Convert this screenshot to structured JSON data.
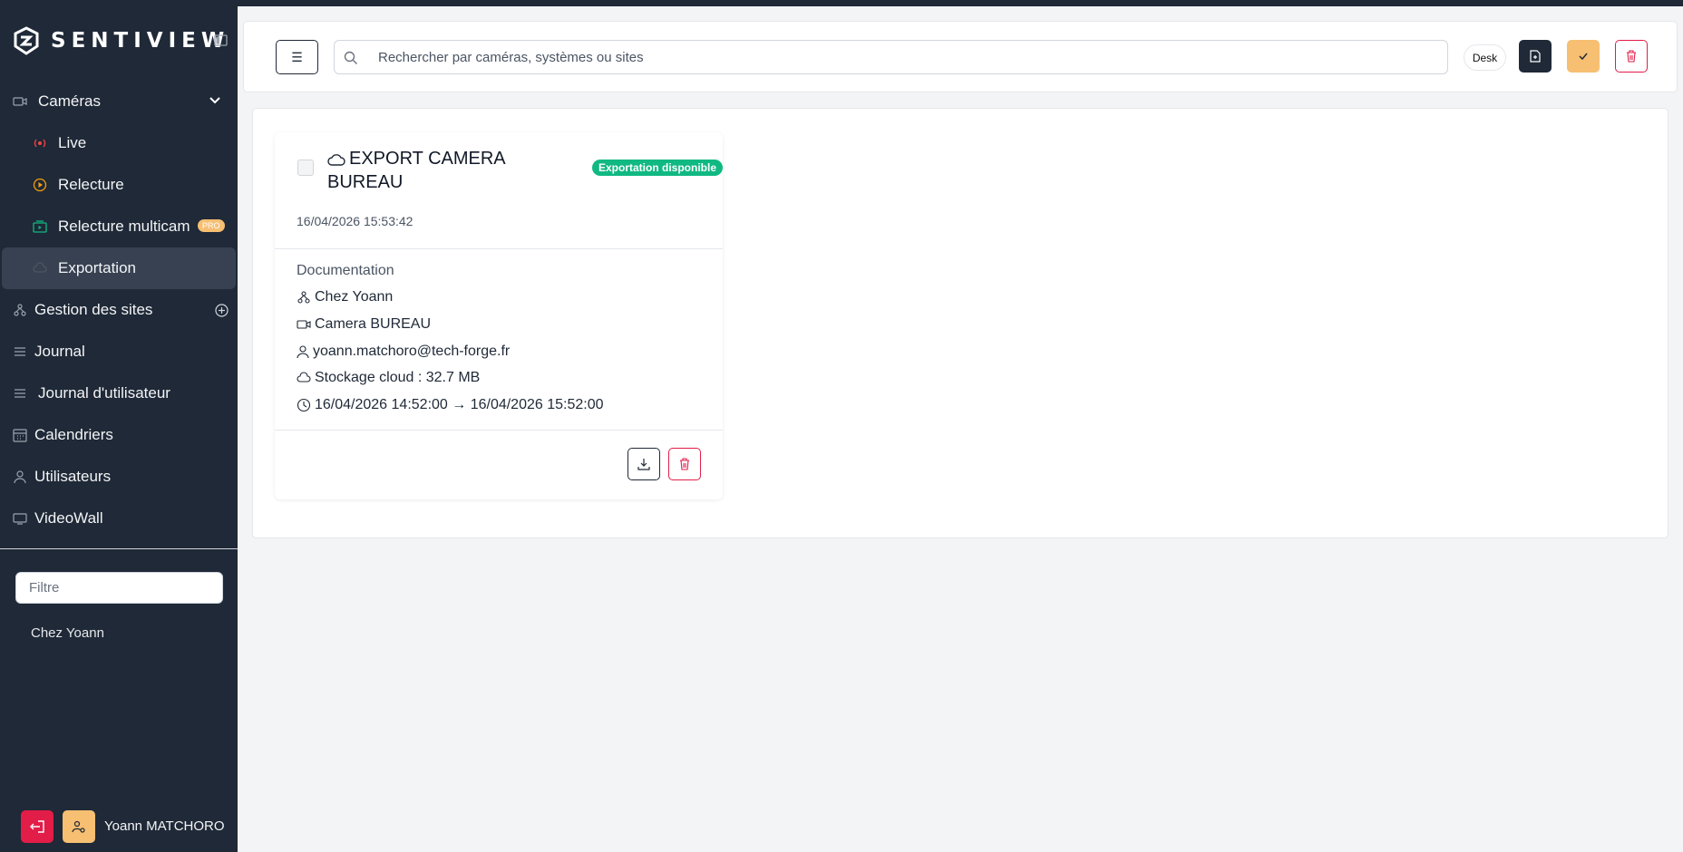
{
  "app": {
    "brand": "SENTIVIEW"
  },
  "colors": {
    "sidebar": "#1f2937",
    "accent_gold": "#f6bf72",
    "danger": "#e11d48",
    "success": "#10b981"
  },
  "sidebar": {
    "items": [
      {
        "label": "Caméras",
        "icon": "camera-icon"
      },
      {
        "label": "Live",
        "icon": "broadcast-icon"
      },
      {
        "label": "Relecture",
        "icon": "play-circle-icon"
      },
      {
        "label": "Relecture multicam",
        "icon": "multicam-icon",
        "badge": "PRO"
      },
      {
        "label": "Exportation",
        "icon": "cloud-icon"
      },
      {
        "label": "Gestion des sites",
        "icon": "sitemap-icon"
      },
      {
        "label": "Journal",
        "icon": "list-icon"
      },
      {
        "label": "Journal d'utilisateur",
        "icon": "list-icon"
      },
      {
        "label": "Calendriers",
        "icon": "calendar-icon"
      },
      {
        "label": "Utilisateurs",
        "icon": "user-icon"
      },
      {
        "label": "VideoWall",
        "icon": "monitor-icon"
      }
    ],
    "filter_placeholder": "Filtre",
    "sites": [
      "Chez Yoann"
    ],
    "user_name": "Yoann MATCHORO"
  },
  "header": {
    "search_placeholder": "Rechercher par caméras, systèmes ou sites",
    "desk_label": "Desk"
  },
  "export_card": {
    "title": "EXPORT CAMERA BUREAU",
    "status_badge": "Exportation disponible",
    "created_at": "16/04/2026 15:53:42",
    "section_label": "Documentation",
    "site": "Chez Yoann",
    "camera": "Camera BUREAU",
    "user_email": "yoann.matchoro@tech-forge.fr",
    "storage": "Stockage cloud : 32.7 MB",
    "time_range": "16/04/2026 14:52:00 → 16/04/2026 15:52:00"
  }
}
